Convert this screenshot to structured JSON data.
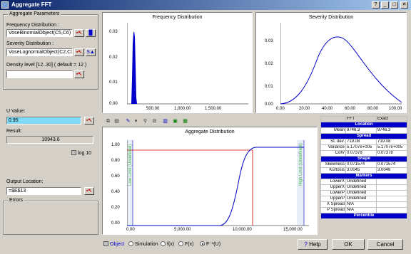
{
  "window": {
    "title": "Aggregate FFT",
    "controls": [
      "?",
      "_",
      "□",
      "✕"
    ]
  },
  "params": {
    "group_title": "Aggregate Parameters",
    "freq_label": "Frequency Distribution :",
    "freq_value": "VoseBinomialObject(C5,C6)",
    "sev_label": "Severity Distribution :",
    "sev_value": "VoseLognormalObject(C2,C3)",
    "density_label": "Density level [12..30]  ( default = 12 )",
    "density_value": ""
  },
  "uvalue": {
    "label": "U Value:",
    "value": "0.95"
  },
  "result": {
    "label": "Result:",
    "value": "10943.6"
  },
  "log10_label": "log 10",
  "output": {
    "label": "Output Location:",
    "value": "=$E$13"
  },
  "errors_title": "Errors",
  "freq_chart": {
    "title": "Frequency Distribution",
    "y_ticks": [
      "0.03",
      "0.02",
      "0.01",
      "0.00"
    ],
    "x_ticks": [
      "500.00",
      "1,000.00",
      "1,500.00"
    ]
  },
  "sev_chart": {
    "title": "Severity Distribution",
    "y_ticks": [
      "0.03",
      "0.02",
      "0.01",
      "0.00"
    ],
    "x_ticks": [
      "0.00",
      "20.00",
      "40.00",
      "60.00",
      "80.00",
      "100.00"
    ]
  },
  "agg_chart": {
    "title": "Aggregate Distribution",
    "y_ticks": [
      "1.00",
      "0.80",
      "0.60",
      "0.40",
      "0.20",
      "0.00"
    ],
    "x_ticks": [
      "0.00",
      "5,000.00",
      "10,000.00",
      "15,000.00"
    ],
    "low_limit": "Low Limit (Undefined)",
    "high_limit": "High Limit (Undefined)"
  },
  "stats": {
    "col_fft": "FFT",
    "col_exact": "Exact",
    "sections": [
      {
        "title": "Location",
        "rows": [
          [
            "Mean",
            "9746.3",
            "9746.3"
          ]
        ]
      },
      {
        "title": "Spread",
        "rows": [
          [
            "St. dev.",
            "719.08",
            "719.08"
          ],
          [
            "Variance",
            "5.1707e+005",
            "5.1707e+005"
          ],
          [
            "CofV",
            "0.07378",
            "0.07378"
          ]
        ]
      },
      {
        "title": "Shape",
        "rows": [
          [
            "Skewness",
            "0.071574",
            "0.071574"
          ],
          [
            "Kurtosis",
            "3.0045",
            "3.0046"
          ]
        ]
      },
      {
        "title": "Markers",
        "rows": [
          [
            "LowerX",
            "Undefined",
            ""
          ],
          [
            "UpperX",
            "Undefined",
            ""
          ],
          [
            "LowerP",
            "Undefined",
            ""
          ],
          [
            "UpperP",
            "Undefined",
            ""
          ],
          [
            "X Spread",
            "N/A",
            ""
          ],
          [
            "P Spread",
            "N/A",
            ""
          ]
        ]
      },
      {
        "title": "Percentile",
        "rows": []
      }
    ]
  },
  "bottom": {
    "object": "Object",
    "simulation": "Simulation",
    "fx": "f(x)",
    "Fx": "F(x)",
    "finv": "F⁻¹(U)"
  },
  "buttons": {
    "help": "Help",
    "ok": "OK",
    "cancel": "Cancel"
  },
  "colors": {
    "accent": "#0000c8",
    "marker": "#cc0000",
    "limit": "#00a000",
    "field_highlight": "#7fdbf5"
  },
  "chart_data": [
    {
      "type": "bar",
      "title": "Frequency Distribution",
      "x_range": [
        0,
        1800
      ],
      "ylim": [
        0,
        0.035
      ],
      "peak_x": 200,
      "peak_y": 0.032
    },
    {
      "type": "line",
      "title": "Severity Distribution",
      "xlim": [
        0,
        100
      ],
      "ylim": [
        0,
        0.035
      ],
      "peak_x": 50,
      "peak_y": 0.032
    },
    {
      "type": "line",
      "title": "Aggregate Distribution",
      "xlim": [
        0,
        15000
      ],
      "ylim": [
        0,
        1.0
      ],
      "u": 0.95,
      "x_at_u": 10943.6
    }
  ]
}
